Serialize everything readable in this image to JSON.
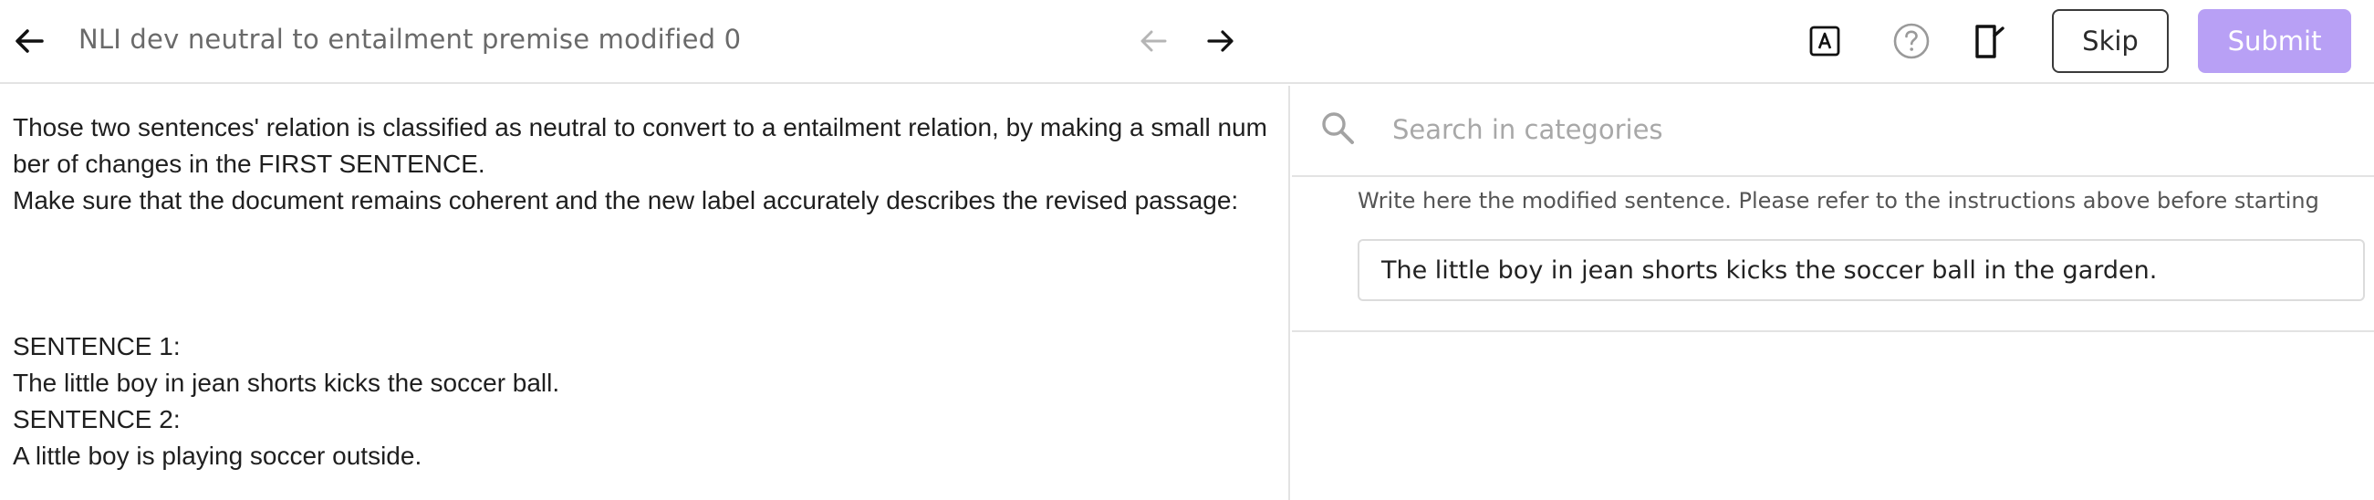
{
  "header": {
    "title": "NLI dev neutral to entailment premise modified 0",
    "skip_label": "Skip",
    "submit_label": "Submit",
    "submit_color": "#b8a0f5"
  },
  "icons": {
    "back": "arrow-left-icon",
    "prev": "arrow-left-icon",
    "next": "arrow-right-icon",
    "text_tool": "letter-a-box-icon",
    "help": "question-circle-icon",
    "flag": "flag-icon",
    "search": "search-icon"
  },
  "instructions": {
    "line1": "Those two sentences' relation is classified as neutral to convert to a entailment relation, by making a small number of changes in the FIRST SENTENCE.",
    "line2": "Make sure that the document remains coherent and the new label accurately describes the revised passage:"
  },
  "sentences": {
    "s1_label": "SENTENCE 1:",
    "s1_text": "The little boy in jean shorts kicks the soccer ball.",
    "s2_label": "SENTENCE 2:",
    "s2_text": "A little boy is playing soccer outside."
  },
  "search": {
    "placeholder": "Search in categories"
  },
  "answer": {
    "label": "Write here the modified sentence. Please refer to the instructions above before starting",
    "value": "The little boy in jean shorts kicks the soccer ball in the garden."
  }
}
